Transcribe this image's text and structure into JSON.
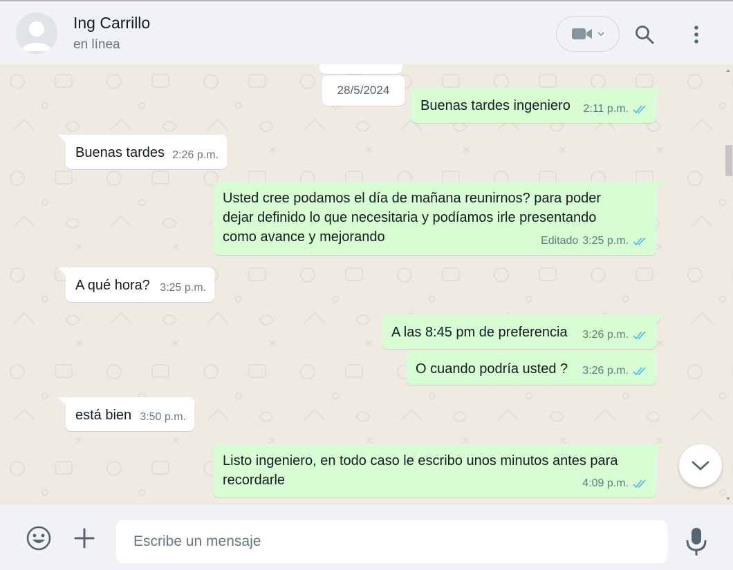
{
  "contact": {
    "name": "Ing Carrillo",
    "status": "en línea"
  },
  "header_icons": {
    "video": "video-camera-icon",
    "search": "search-icon",
    "menu": "menu-dots-icon"
  },
  "date_separator": "28/5/2024",
  "messages": [
    {
      "direction": "out",
      "text": "Buenas tardes ingeniero",
      "time": "2:11 p.m.",
      "status": "read"
    },
    {
      "direction": "in",
      "text": "Buenas tardes",
      "time": "2:26 p.m."
    },
    {
      "direction": "out",
      "lines": [
        "Usted cree podamos el día de mañana reunirnos? para poder",
        "dejar definido lo que necesitaria y podíamos irle presentando",
        "como avance y mejorando"
      ],
      "edited": "Editado",
      "time": "3:25 p.m.",
      "status": "read"
    },
    {
      "direction": "in",
      "text": "A qué hora?",
      "time": "3:25 p.m."
    },
    {
      "direction": "out",
      "text": "A las 8:45 pm de preferencia",
      "time": "3:26 p.m.",
      "status": "read"
    },
    {
      "direction": "out",
      "text": "O cuando podría usted ?",
      "time": "3:26 p.m.",
      "status": "read"
    },
    {
      "direction": "in",
      "text": "está bien",
      "time": "3:50 p.m."
    },
    {
      "direction": "out",
      "lines": [
        "Listo ingeniero, en todo caso le escribo unos minutos antes para",
        "recordarle"
      ],
      "time": "4:09 p.m.",
      "status": "read"
    }
  ],
  "composer": {
    "placeholder": "Escribe un mensaje"
  },
  "colors": {
    "incoming": "#ffffff",
    "outgoing": "#d9fdd3",
    "read_ticks": "#53bdeb",
    "background": "#efeae2",
    "header": "#f0f2f5"
  }
}
